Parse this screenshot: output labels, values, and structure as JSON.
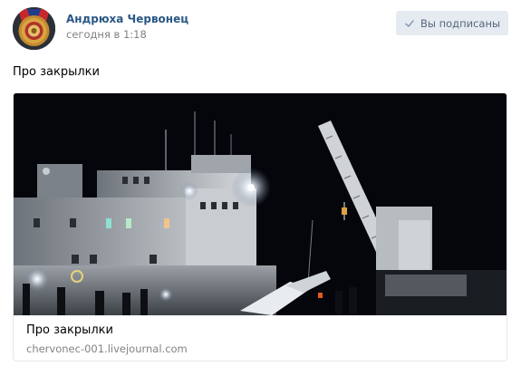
{
  "post": {
    "author": "Андрюха Червонец",
    "time": "сегодня в 1:18",
    "subscribe_label": "Вы подписаны",
    "text": "Про закрылки"
  },
  "link_card": {
    "title": "Про закрылки",
    "domain": "chervonec-001.livejournal.com"
  },
  "colors": {
    "author_link": "#2a5885",
    "secondary_text": "#828282",
    "button_bg": "#e5ebf1",
    "button_text": "#55677d"
  }
}
